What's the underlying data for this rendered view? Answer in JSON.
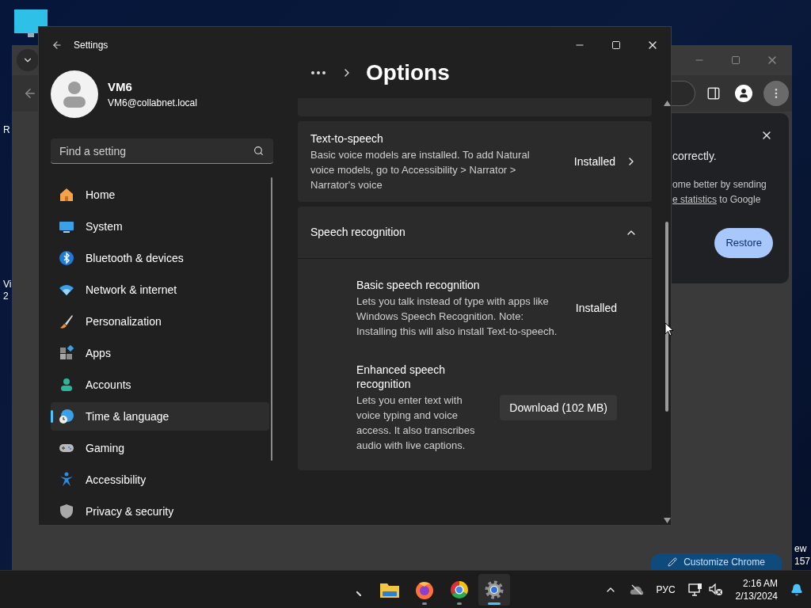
{
  "desktop": {
    "left_labels": [
      "R",
      "Vi",
      "2"
    ],
    "right_labels": [
      "ew",
      "157"
    ]
  },
  "browser": {
    "notice": {
      "heading": "correctly.",
      "line_1": "ome better by sending",
      "link": "e statistics",
      "line_2_rest": " to Google",
      "button": "Restore"
    },
    "customize_button": "Customize Chrome"
  },
  "settings": {
    "title": "Settings",
    "user": {
      "name": "VM6",
      "email": "VM6@collabnet.local"
    },
    "search": {
      "placeholder": "Find a setting"
    },
    "nav": [
      {
        "kind": "home",
        "label": "Home",
        "selected": false
      },
      {
        "kind": "system",
        "label": "System",
        "selected": false
      },
      {
        "kind": "bluetooth",
        "label": "Bluetooth & devices",
        "selected": false
      },
      {
        "kind": "network",
        "label": "Network & internet",
        "selected": false
      },
      {
        "kind": "personalization",
        "label": "Personalization",
        "selected": false
      },
      {
        "kind": "apps",
        "label": "Apps",
        "selected": false
      },
      {
        "kind": "accounts",
        "label": "Accounts",
        "selected": false
      },
      {
        "kind": "time",
        "label": "Time & language",
        "selected": true
      },
      {
        "kind": "gaming",
        "label": "Gaming",
        "selected": false
      },
      {
        "kind": "accessibility",
        "label": "Accessibility",
        "selected": false
      },
      {
        "kind": "privacy",
        "label": "Privacy & security",
        "selected": false
      }
    ],
    "page_title": "Options",
    "tts": {
      "title": "Text-to-speech",
      "description": "Basic voice models are installed. To add Natural voice models, go to Accessibility > Narrator > Narrator's voice",
      "status": "Installed"
    },
    "speech": {
      "title": "Speech recognition",
      "expanded": true,
      "items": [
        {
          "kind": "status",
          "title": "Basic speech recognition",
          "description": "Lets you talk instead of type with apps like Windows Speech Recognition. Note: Installing this will also install Text-to-speech.",
          "control": "Installed"
        },
        {
          "kind": "action",
          "title": "Enhanced speech recognition",
          "description": "Lets you enter text with voice typing and voice access. It also transcribes audio with live captions.",
          "control": "Download (102 MB)"
        }
      ]
    }
  },
  "taskbar": {
    "apps": [
      {
        "kind": "explorer",
        "running": false,
        "active": false
      },
      {
        "kind": "firefox",
        "running": true,
        "active": false
      },
      {
        "kind": "chrome",
        "running": true,
        "active": false
      },
      {
        "kind": "settings",
        "running": true,
        "active": true
      }
    ],
    "language": "РУС",
    "time": "2:16 AM",
    "date": "2/13/2024"
  }
}
